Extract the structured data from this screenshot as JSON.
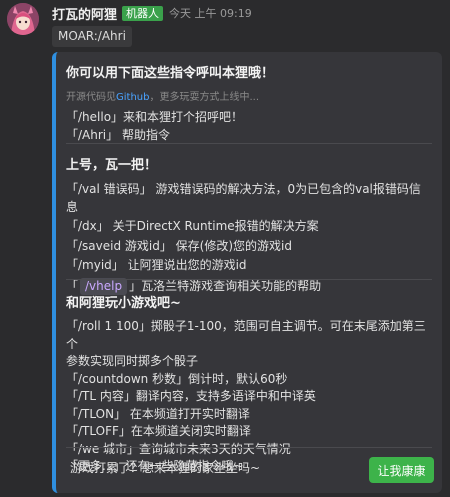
{
  "header": {
    "name": "打瓦的阿狸",
    "bot_badge": "机器人",
    "time": "今天 上午 09:19"
  },
  "command": "MOAR:/Ahri",
  "card": {
    "intro": {
      "title": "你可以用下面这些指令呼叫本狸哦！",
      "sub_prefix": "开源代码见",
      "sub_link": "Github",
      "sub_suffix": "，更多玩耍方式上线中...",
      "lines": [
        "「/hello」来和本狸打个招呼吧！",
        "「/Ahri」 帮助指令"
      ]
    },
    "valorant": {
      "title": "上号，瓦一把！",
      "lines": [
        "「/val 错误码」 游戏错误码的解决方法，0为已包含的val报错码信息",
        "「/dx」 关于DirectX Runtime报错的解决方案",
        "「/saveid 游戏id」 保存(修改)您的游戏id",
        "「/myid」 让阿狸说出您的游戏id"
      ],
      "help_pre": "「",
      "help_cmd": "/vhelp",
      "help_post": "」瓦洛兰特游戏查询相关功能的帮助"
    },
    "games": {
      "title": "和阿狸玩小游戏吧~",
      "lines": [
        "「/roll 1 100」掷骰子1-100，范围可自主调节。可在末尾添加第三个",
        "参数实现同时掷多个骰子",
        "「/countdown 秒数」倒计时，默认60秒",
        "「/TL 内容」翻译内容，支持多语译中和中译英",
        "「/TLON」 在本频道打开实时翻译",
        "「/TLOFF」在本频道关闭实时翻译",
        "「/we 城市」查询城市未来3天的天气情况",
        "「更多...」还有一些隐藏指令哦~"
      ]
    },
    "footer_text": "游戏打累了？想来本狸的家坐坐吗~",
    "button_label": "让我康康"
  }
}
